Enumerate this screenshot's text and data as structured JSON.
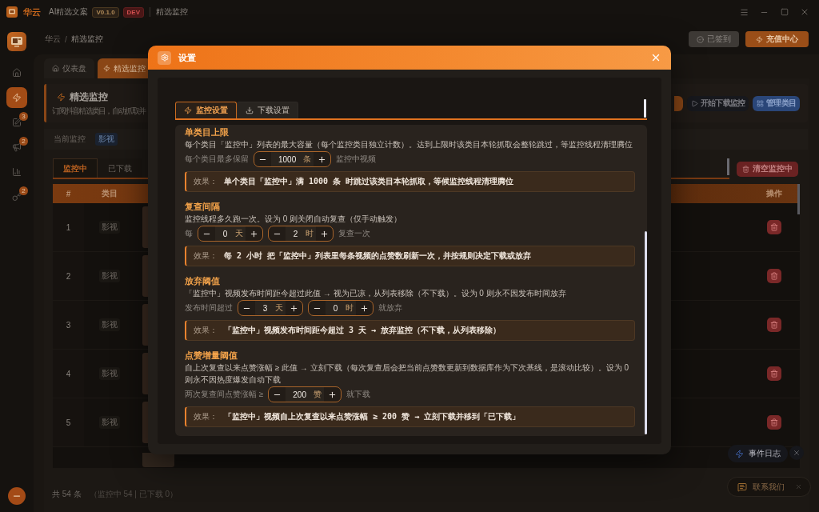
{
  "title_bar": {
    "brand": "华云",
    "app_name": "AI精选文案",
    "version": "V0.1.0",
    "env": "DEV",
    "page": "精选监控"
  },
  "sidebar": {
    "items": [
      {
        "kind": "home",
        "selected": false
      },
      {
        "kind": "monitor",
        "selected": true
      },
      {
        "kind": "edit",
        "badge": "3",
        "selected": false
      },
      {
        "kind": "announce",
        "badge": "2",
        "selected": false
      },
      {
        "kind": "stats",
        "selected": false
      },
      {
        "kind": "tools",
        "badge": "2",
        "selected": false
      }
    ]
  },
  "breadcrumb": {
    "items": [
      "华云",
      "精选监控"
    ],
    "separator": "/"
  },
  "header_buttons": [
    {
      "kind": "checked_in",
      "label": "已签到"
    },
    {
      "kind": "recharge",
      "label": "充值中心"
    }
  ],
  "page_tabs": [
    {
      "kind": "home",
      "label": "仪表盘",
      "selected": false
    },
    {
      "kind": "monitor",
      "label": "精选监控",
      "selected": true
    }
  ],
  "page_card": {
    "title": "精选监控",
    "subtitle": "订阅抖音精选类目，自动抓取并",
    "actions": [
      {
        "kind": "primary"
      },
      {
        "kind": "start",
        "label": "开始下载监控"
      },
      {
        "kind": "manage",
        "label": "管理类目"
      }
    ]
  },
  "filter": {
    "label": "当前监控",
    "tag": "影视"
  },
  "list_tabs": [
    {
      "label": "监控中",
      "selected": true
    },
    {
      "label": "已下载",
      "selected": false
    }
  ],
  "clear_button": {
    "label": "清空监控中"
  },
  "table": {
    "columns": [
      "#",
      "类目",
      "操作"
    ],
    "rows": [
      {
        "index": "1",
        "category": "影视"
      },
      {
        "index": "2",
        "category": "影视"
      },
      {
        "index": "3",
        "category": "影视"
      },
      {
        "index": "4",
        "category": "影视"
      },
      {
        "index": "5",
        "category": "影视"
      }
    ]
  },
  "footer": {
    "total": "共 54 条",
    "summary": "（监控中 54 | 已下载 0）"
  },
  "event_log": {
    "label": "事件日志"
  },
  "contact": {
    "label": "联系我们"
  },
  "settings_dialog": {
    "title": "设置",
    "tabs": [
      {
        "kind": "monitor",
        "label": "监控设置",
        "selected": true
      },
      {
        "kind": "download",
        "label": "下载设置",
        "selected": false
      }
    ],
    "sections": [
      {
        "title": "单类目上限",
        "description": "每个类目「监控中」列表的最大容量（每个监控类目独立计数）。达到上限时该类目本轮抓取会整轮跳过，等监控线程清理腾位",
        "controls": [
          {
            "kind": "text",
            "text": "每个类目最多保留"
          },
          {
            "kind": "stepper",
            "value": "1000",
            "unit": "条"
          },
          {
            "kind": "text",
            "text": "监控中视频"
          }
        ],
        "effect_label": "效果：",
        "effect": "单个类目「监控中」满 1000 条 时跳过该类目本轮抓取，等候监控线程清理腾位"
      },
      {
        "title": "复查间隔",
        "description": "监控线程多久跑一次。设为 0 则关闭自动复查（仅手动触发）",
        "controls": [
          {
            "kind": "text",
            "text": "每"
          },
          {
            "kind": "stepper",
            "value": "0",
            "unit": "天"
          },
          {
            "kind": "stepper",
            "value": "2",
            "unit": "时"
          },
          {
            "kind": "text",
            "text": "复查一次"
          }
        ],
        "effect_label": "效果：",
        "effect": "每 2 小时 把「监控中」列表里每条视频的点赞数刷新一次，并按规则决定下载或放弃"
      },
      {
        "title": "放弃阈值",
        "description": "「监控中」视频发布时间距今超过此值 → 视为已凉，从列表移除（不下载）。设为 0 则永不因发布时间放弃",
        "controls": [
          {
            "kind": "text",
            "text": "发布时间超过"
          },
          {
            "kind": "stepper",
            "value": "3",
            "unit": "天"
          },
          {
            "kind": "stepper",
            "value": "0",
            "unit": "时"
          },
          {
            "kind": "text",
            "text": "就放弃"
          }
        ],
        "effect_label": "效果：",
        "effect": "「监控中」视频发布时间距今超过 3 天 → 放弃监控（不下载，从列表移除）"
      },
      {
        "title": "点赞增量阈值",
        "description": "自上次复查以来点赞涨幅 ≥ 此值 → 立刻下载（每次复查后会把当前点赞数更新到数据库作为下次基线，是滚动比较）。设为 0 则永不因热度爆发自动下载",
        "controls": [
          {
            "kind": "text",
            "text": "两次复查间点赞涨幅 ≥"
          },
          {
            "kind": "stepper",
            "value": "200",
            "unit": "赞"
          },
          {
            "kind": "text",
            "text": "就下载"
          }
        ],
        "effect_label": "效果：",
        "effect": "「监控中」视频自上次复查以来点赞涨幅 ≥ 200 赞 → 立刻下载并移到「已下载」"
      }
    ]
  }
}
